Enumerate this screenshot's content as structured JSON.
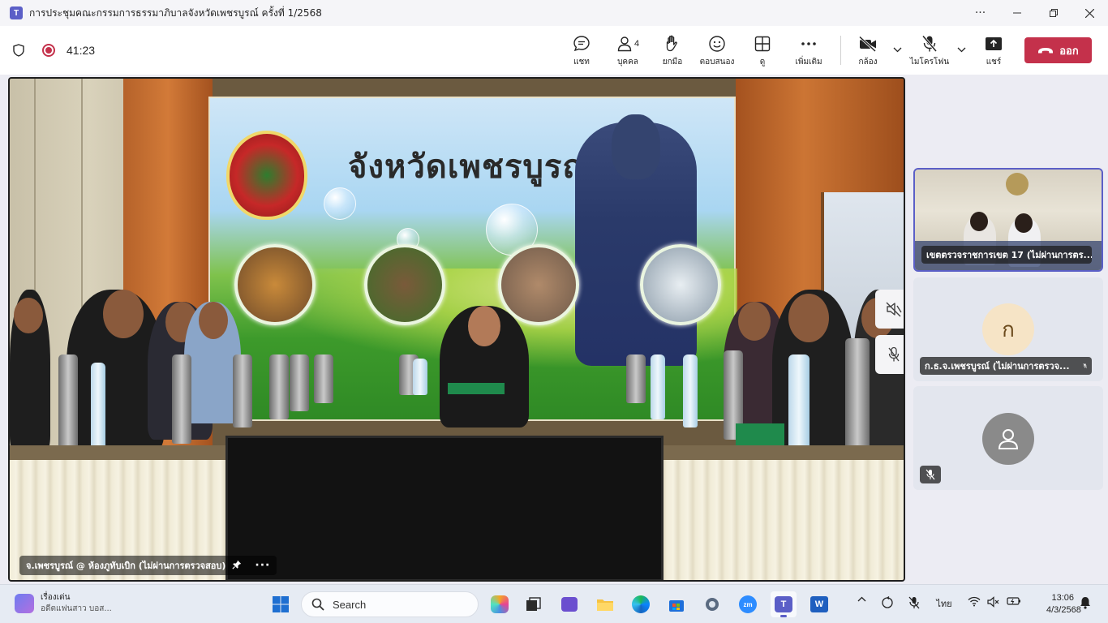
{
  "window": {
    "title": "การประชุมคณะกรรมการธรรมาภิบาลจังหวัดเพชรบูรณ์ ครั้งที่ 1/2568",
    "app_icon_letter": "T"
  },
  "meeting": {
    "timer": "41:23",
    "toolbar": {
      "chat": "แชท",
      "people": "บุคคล",
      "people_count": "4",
      "raise": "ยกมือ",
      "react": "ตอบสนอง",
      "view": "ดู",
      "more": "เพิ่มเติม",
      "camera": "กล้อง",
      "mic": "ไมโครโฟน",
      "share": "แชร์",
      "leave": "ออก"
    },
    "accent_color": "#5b5fc7",
    "leave_color": "#c4314b"
  },
  "stage": {
    "banner_heading": "จังหวัดเพชรบูรณ์",
    "caption": "จ.เพชรบูรณ์ @ ห้องภูทับเบิก (ไม่ผ่านการตรวจสอบ)",
    "more_glyph": "···"
  },
  "participants": [
    {
      "name": "เขตตรวจราชการเขต 17 (ไม่ผ่านการตร...",
      "type": "video"
    },
    {
      "name": "ก.ธ.จ.เพชรบูรณ์ (ไม่ผ่านการตรวจ...",
      "type": "initial",
      "initial": "ก",
      "muted": true
    },
    {
      "name": "",
      "type": "placeholder",
      "muted": true
    }
  ],
  "taskbar": {
    "news_title": "เรื่องเด่น",
    "news_sub": "อดีตแฟนสาว บอส...",
    "search_placeholder": "Search",
    "language": "ไทย",
    "time": "13:06",
    "date": "4/3/2568"
  }
}
